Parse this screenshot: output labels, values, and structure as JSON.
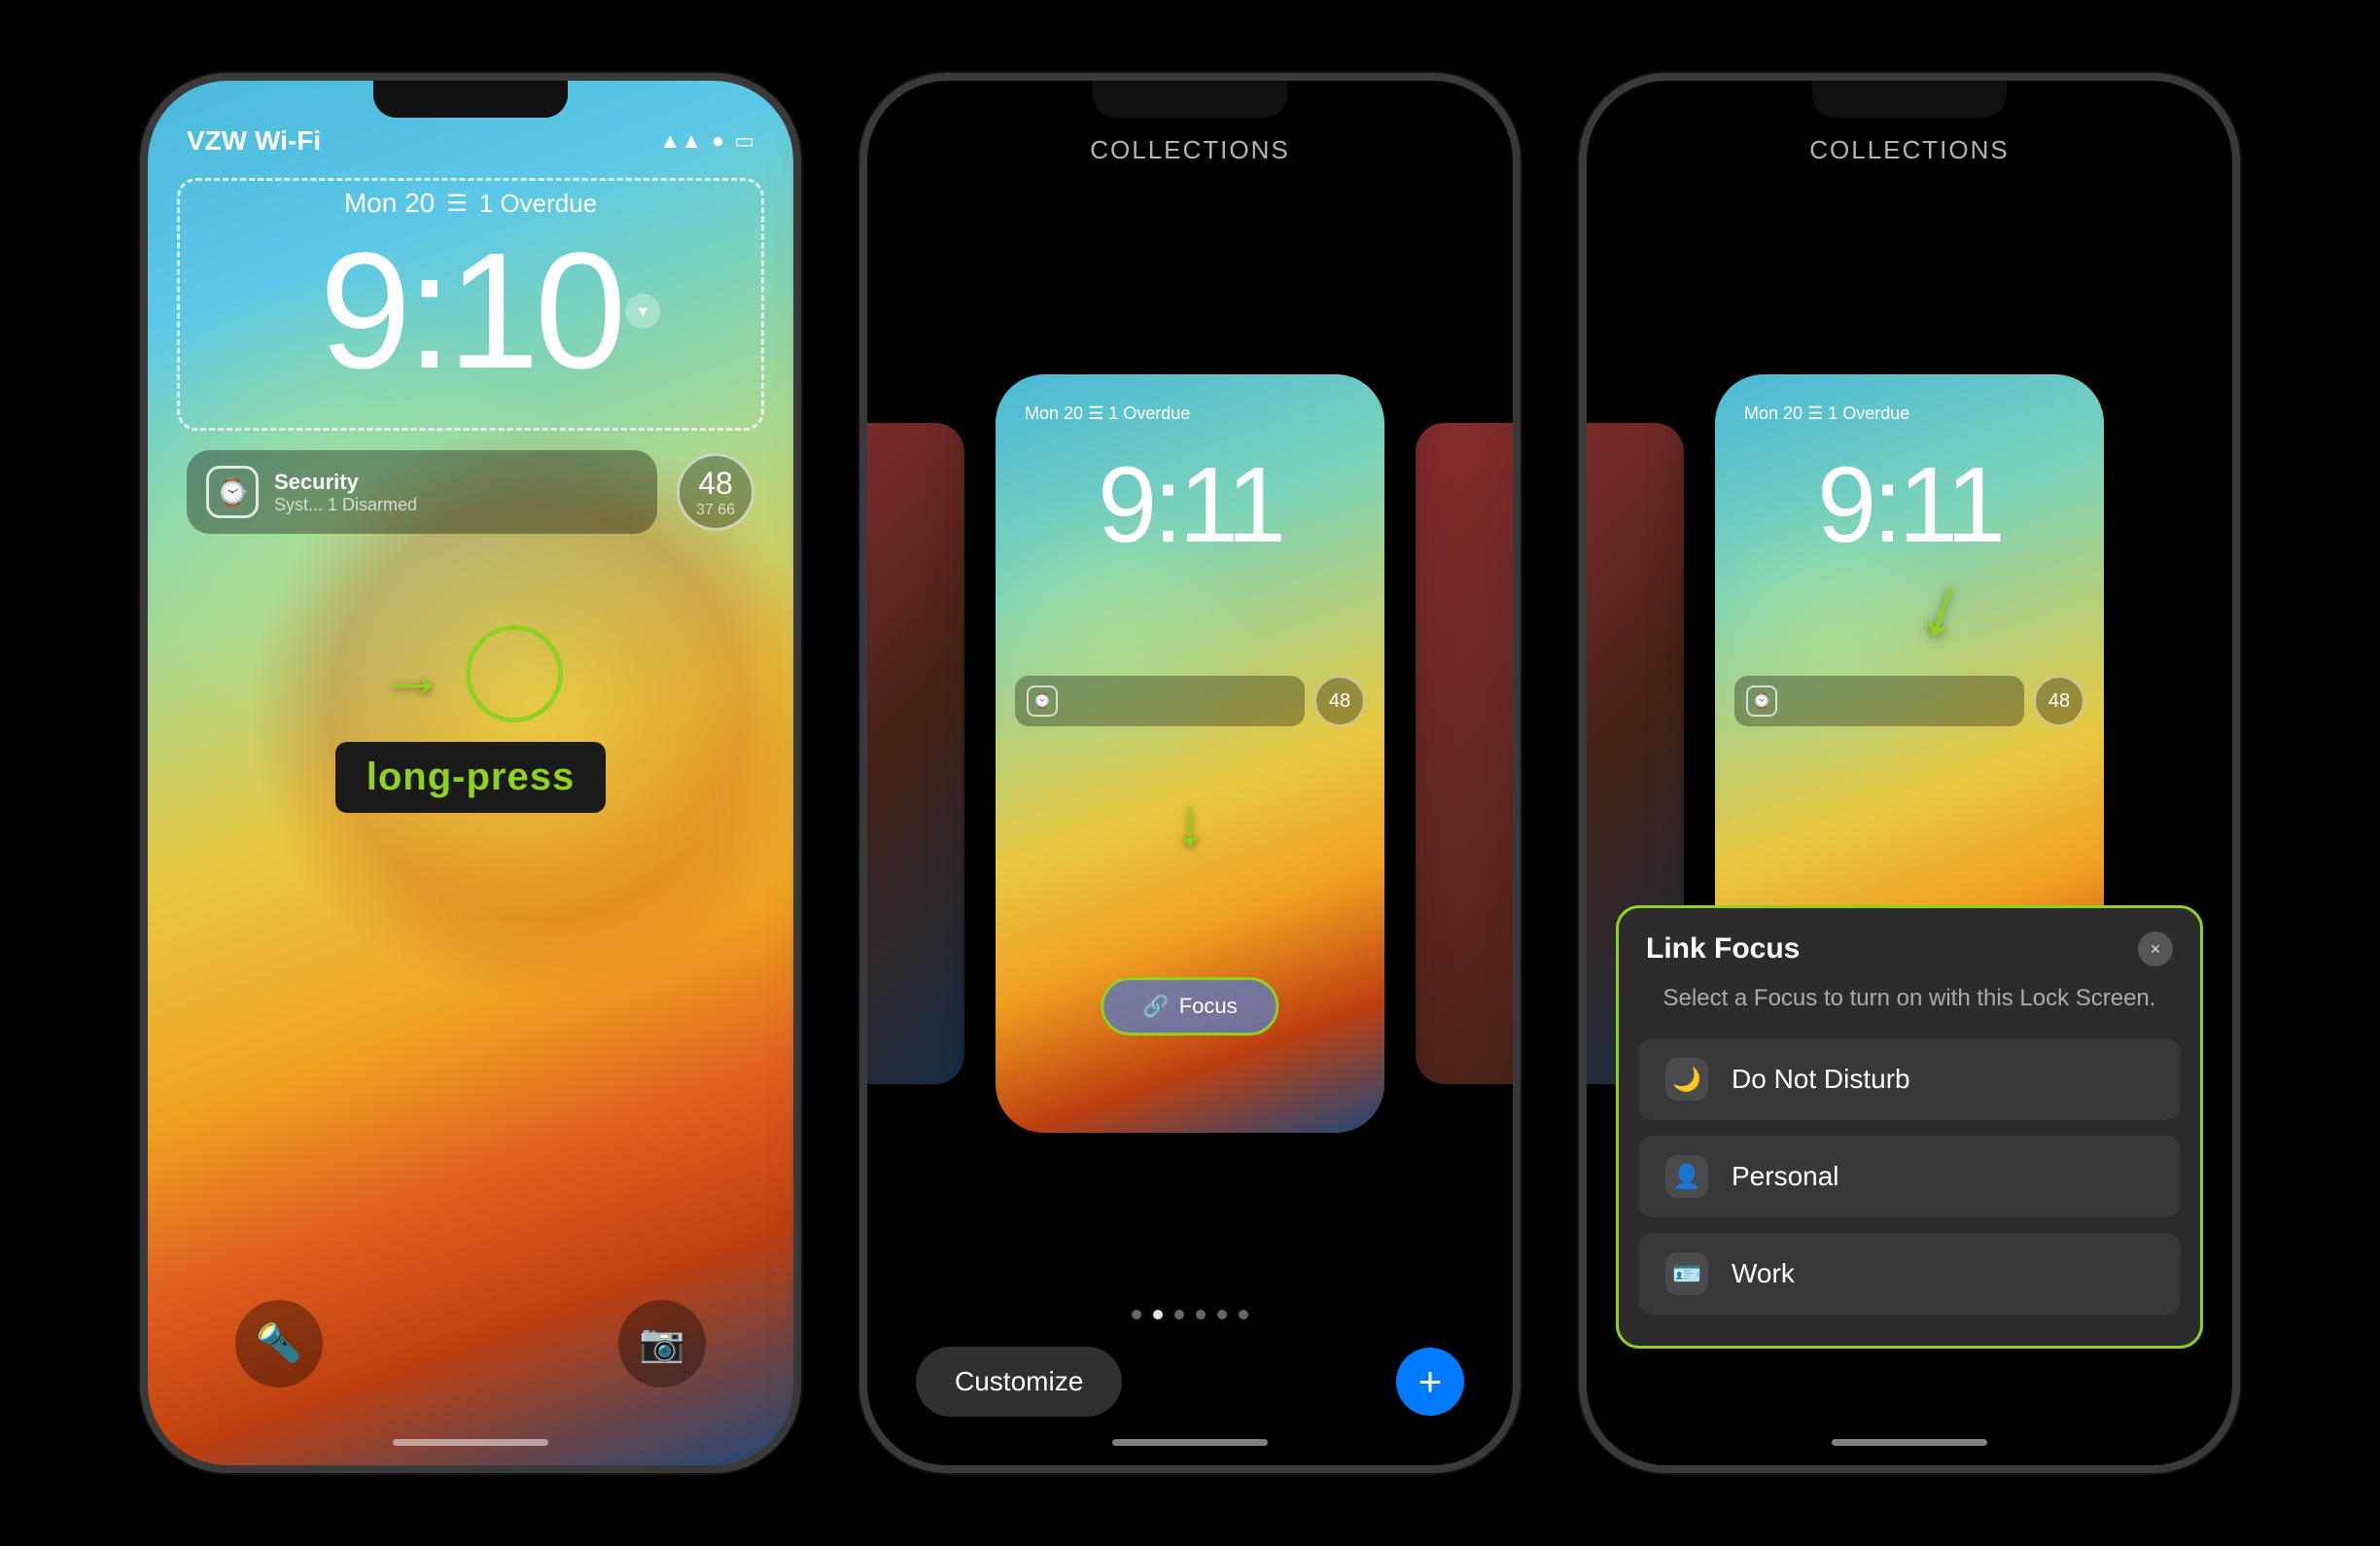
{
  "phone1": {
    "carrier": "VZW Wi-Fi",
    "date": "Mon 20",
    "overdue": "1 Overdue",
    "time": "9:10",
    "widget_title": "Security",
    "widget_subtitle": "Syst... 1 Disarmed",
    "circle_number": "48",
    "circle_sub": "37 66",
    "annotation": "long-press"
  },
  "phone2": {
    "collections_label": "COLLECTIONS",
    "mini_date": "Mon 20",
    "mini_overdue": "1 Overdue",
    "mini_time": "9:11",
    "mini_circle": "48",
    "focus_button_label": "Focus",
    "customize_btn": "Customize",
    "add_btn": "+"
  },
  "phone3": {
    "collections_label": "COLLECTIONS",
    "mini_date": "Mon 20",
    "mini_overdue": "1 Overdue",
    "mini_time": "9:11",
    "mini_circle": "48",
    "modal": {
      "title": "Link Focus",
      "subtitle": "Select a Focus to turn on with this Lock Screen.",
      "close_label": "×",
      "options": [
        {
          "icon": "🌙",
          "label": "Do Not Disturb"
        },
        {
          "icon": "👤",
          "label": "Personal"
        },
        {
          "icon": "🪪",
          "label": "Work"
        }
      ]
    }
  }
}
